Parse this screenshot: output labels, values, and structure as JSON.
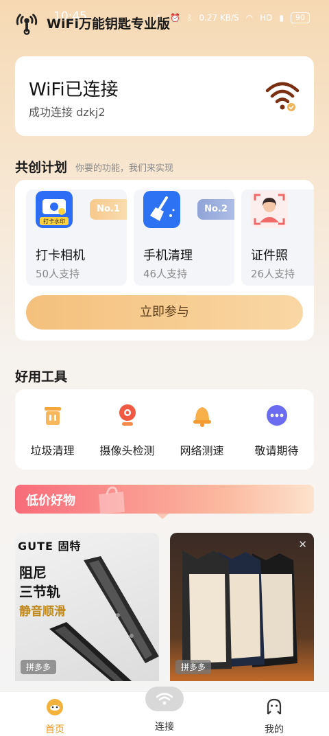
{
  "status_bar": {
    "time": "10:45",
    "net_speed": "0.27 KB/S",
    "hd": "HD",
    "battery": "90"
  },
  "header": {
    "title": "WiFi万能钥匙专业版"
  },
  "wifi_card": {
    "status": "WiFi已连接",
    "subtitle": "成功连接 dzkj2"
  },
  "plan": {
    "title": "共创计划",
    "subtitle": "你要的功能，我们来实现",
    "items": [
      {
        "name": "打卡相机",
        "count": "50人支持",
        "badge": "No.1",
        "icon_text": "打卡水印"
      },
      {
        "name": "手机清理",
        "count": "46人支持",
        "badge": "No.2"
      },
      {
        "name": "证件照",
        "count": "26人支持"
      }
    ],
    "join_label": "立即参与"
  },
  "tools": {
    "title": "好用工具",
    "items": [
      {
        "label": "垃圾清理",
        "icon": "trash-icon"
      },
      {
        "label": "摄像头检测",
        "icon": "camera-detect-icon"
      },
      {
        "label": "网络测速",
        "icon": "speed-test-icon"
      },
      {
        "label": "敬请期待",
        "icon": "more-icon"
      }
    ]
  },
  "deals": {
    "title": "低价好物",
    "products": [
      {
        "brand": "GUTE 固特",
        "headline_1": "阻尼",
        "headline_2": "三节轨",
        "tagline": "静音顺滑",
        "tag": "拼多多"
      },
      {
        "tag": "拼多多"
      }
    ]
  },
  "bottom_nav": {
    "items": [
      {
        "label": "首页",
        "icon": "home-icon",
        "active": true
      },
      {
        "label": "连接",
        "icon": "wifi-icon"
      },
      {
        "label": "我的",
        "icon": "profile-icon"
      }
    ]
  },
  "colors": {
    "accent": "#e79a24",
    "wifi_icon": "#7a2e12",
    "deal_red": "#f86b7a"
  }
}
